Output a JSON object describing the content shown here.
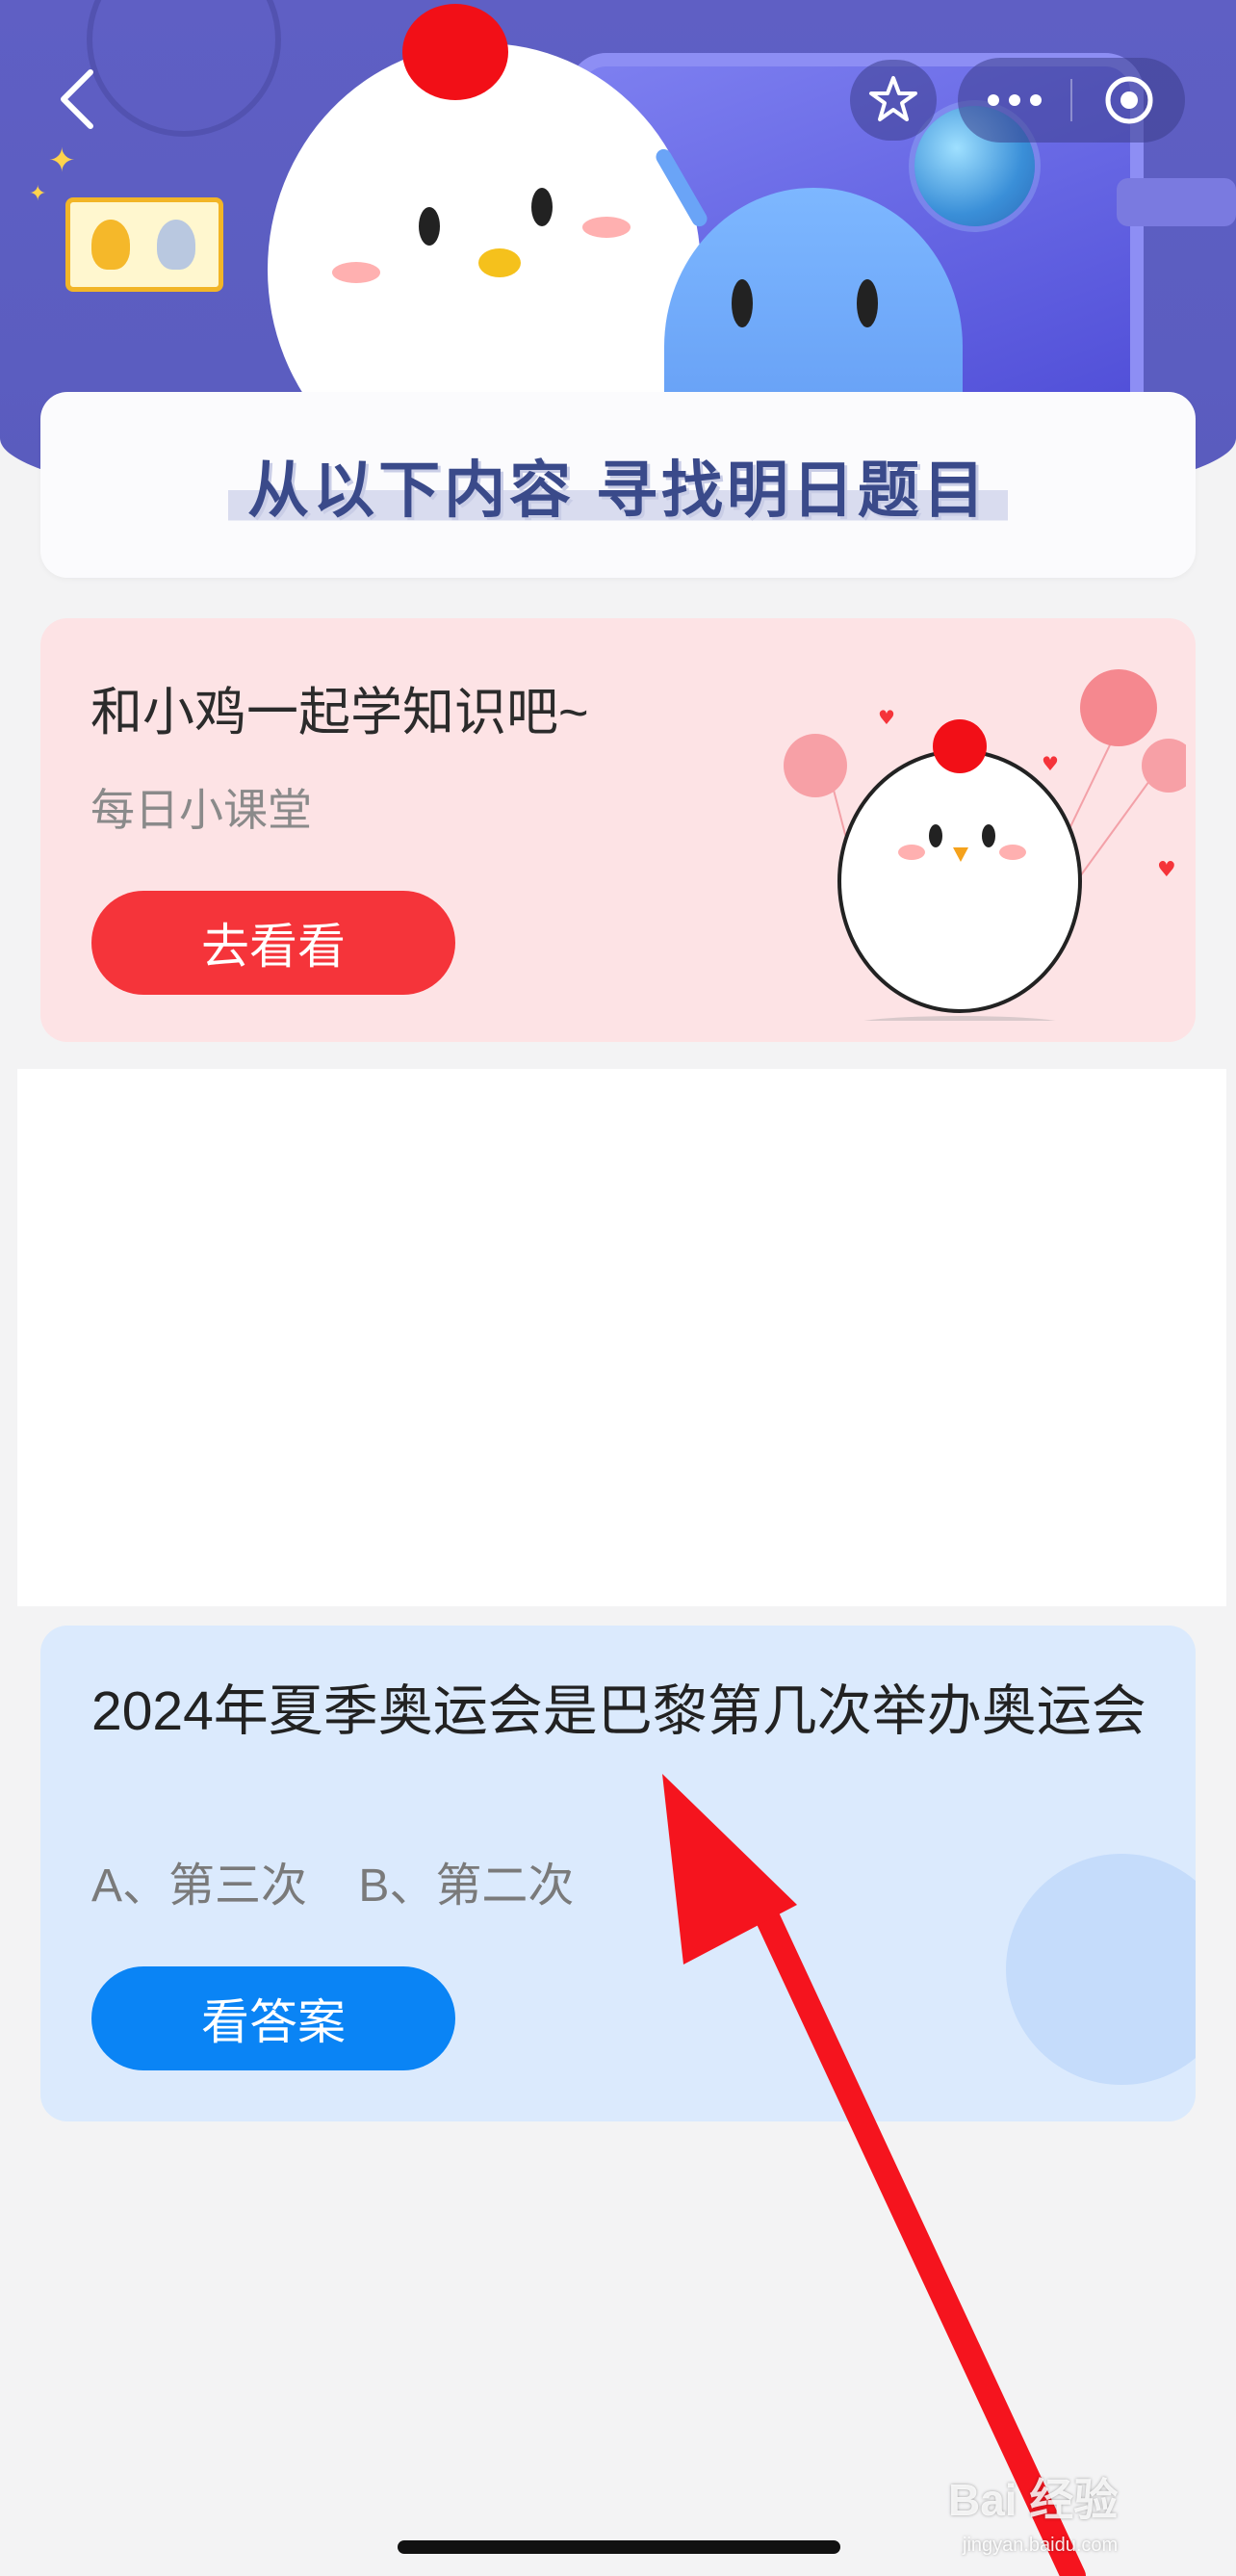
{
  "header": {
    "banner_title": "从以下内容 寻找明日题目"
  },
  "nav": {
    "back_icon": "chevron-left-icon",
    "favorite_icon": "star-icon",
    "more_icon": "more-dots-icon",
    "close_icon": "target-close-icon"
  },
  "learn_card": {
    "title": "和小鸡一起学知识吧~",
    "subtitle": "每日小课堂",
    "button_label": "去看看",
    "accent": "#f5343a"
  },
  "question_card": {
    "question": "2024年夏季奥运会是巴黎第几次举办奥运会",
    "options_line": "A、第三次    B、第二次",
    "button_label": "看答案",
    "accent": "#0a84f5"
  },
  "watermark": {
    "brand": "Bai 经验",
    "url": "jingyan.baidu.com"
  },
  "colors": {
    "hero_bg": "#5f5fc4",
    "page_bg": "#f3f3f4",
    "annotation_arrow": "#f5141e"
  }
}
